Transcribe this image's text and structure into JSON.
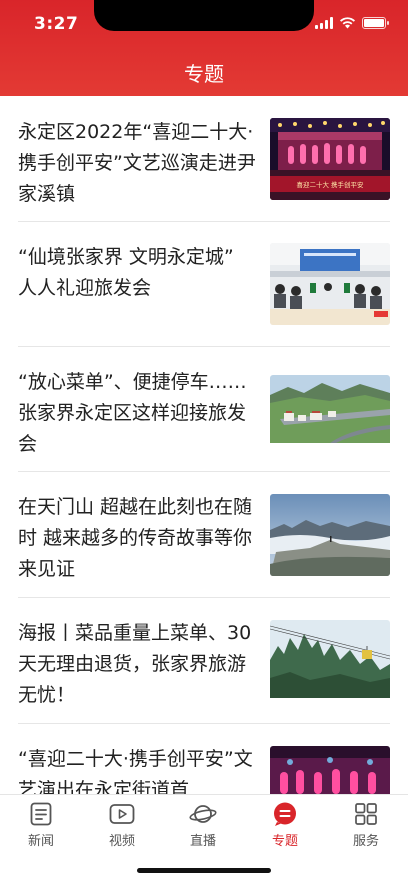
{
  "status": {
    "time": "3:27"
  },
  "header": {
    "title": "专题"
  },
  "articles": [
    {
      "title": "永定区2022年“喜迎二十大·携手创平安”文艺巡演走进尹家溪镇",
      "image": "stage-performance",
      "image_caption": "喜迎二十大 携手创平安"
    },
    {
      "title": "“仙境张家界 文明永定城” 人人礼迎旅发会",
      "image": "conference-meeting"
    },
    {
      "title": "“放心菜单”、便捷停车……张家界永定区这样迎接旅发会",
      "image": "aerial-town-highway"
    },
    {
      "title": "在天门山 超越在此刻也在随时 越来越多的传奇故事等你来见证",
      "image": "mountain-sea-of-clouds"
    },
    {
      "title": "海报丨菜品重量上菜单、30天无理由退货，张家界旅游无忧！",
      "image": "cable-car-peaks"
    },
    {
      "title": "“喜迎二十大·携手创平安”文艺演出在永定街道首",
      "image": "stage-performance-2"
    }
  ],
  "tabs": [
    {
      "label": "新闻",
      "icon": "news-icon",
      "active": false
    },
    {
      "label": "视频",
      "icon": "video-icon",
      "active": false
    },
    {
      "label": "直播",
      "icon": "live-icon",
      "active": false
    },
    {
      "label": "专题",
      "icon": "topic-icon",
      "active": true
    },
    {
      "label": "服务",
      "icon": "services-grid-icon",
      "active": false
    }
  ],
  "colors": {
    "brand": "#d9252a",
    "text": "#222222",
    "tab_text": "#555555"
  }
}
